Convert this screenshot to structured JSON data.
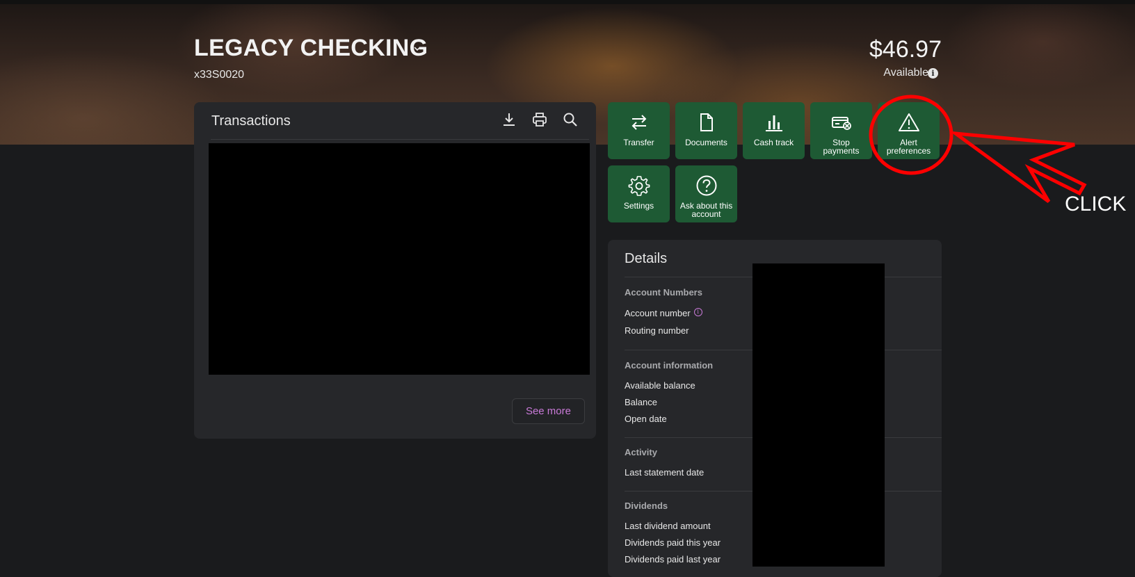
{
  "account": {
    "name": "LEGACY CHECKING",
    "number_masked": "x33S0020",
    "balance": "$46.97",
    "balance_label": "Available"
  },
  "transactions": {
    "title": "Transactions",
    "see_more": "See more"
  },
  "actions": [
    {
      "label": "Transfer",
      "icon": "transfer-icon"
    },
    {
      "label": "Documents",
      "icon": "document-icon"
    },
    {
      "label": "Cash track",
      "icon": "bar-chart-icon"
    },
    {
      "label": "Stop payments",
      "icon": "stop-payment-icon"
    },
    {
      "label": "Alert preferences",
      "icon": "alert-triangle-icon"
    },
    {
      "label": "Settings",
      "icon": "gear-icon"
    },
    {
      "label": "Ask about this account",
      "icon": "question-icon"
    }
  ],
  "details": {
    "title": "Details",
    "sections": [
      {
        "heading": "Account Numbers",
        "rows": [
          "Account number",
          "Routing number"
        ]
      },
      {
        "heading": "Account information",
        "rows": [
          "Available balance",
          "Balance",
          "Open date"
        ]
      },
      {
        "heading": "Activity",
        "rows": [
          "Last statement date"
        ]
      },
      {
        "heading": "Dividends",
        "rows": [
          "Last dividend amount",
          "Dividends paid this year",
          "Dividends paid last year"
        ]
      }
    ]
  },
  "annotation": {
    "text": "CLICK",
    "color": "#ff0000"
  },
  "colors": {
    "action_bg": "#1e5a34",
    "panel_bg": "#26272a",
    "page_bg": "#1a1b1d",
    "link": "#c97ad8"
  }
}
